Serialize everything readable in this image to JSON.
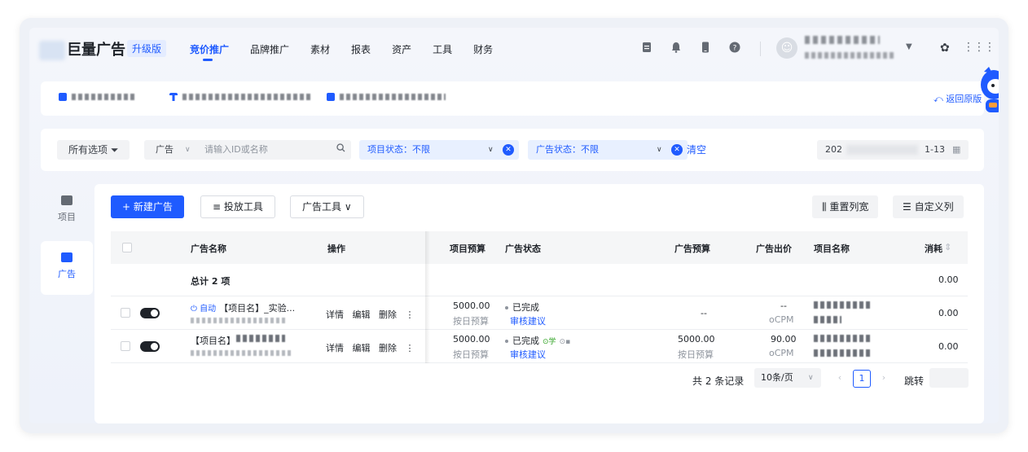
{
  "brand": {
    "title": "巨量广告",
    "edition": "升级版"
  },
  "nav": {
    "items": [
      "竞价推广",
      "品牌推广",
      "素材",
      "报表",
      "资产",
      "工具",
      "财务"
    ],
    "active": "竞价推广"
  },
  "account": {
    "back_label": "返回原版"
  },
  "filters": {
    "all_options": "所有选项",
    "search_type": "广告",
    "search_placeholder": "请输入ID或名称",
    "project_status": "项目状态：不限",
    "ad_status": "广告状态：不限",
    "clear": "清空",
    "date_prefix": "202",
    "date_suffix": "1-13"
  },
  "sidebar": {
    "items": [
      {
        "label": "项目"
      },
      {
        "label": "广告"
      }
    ],
    "active": "广告"
  },
  "toolbar": {
    "new_ad": "+ 新建广告",
    "delivery_tools": "≡ 投放工具",
    "ad_tools": "广告工具",
    "reset_cols": "重置列宽",
    "custom_cols": "自定义列"
  },
  "table": {
    "headers": {
      "name": "广告名称",
      "ops": "操作",
      "project_budget": "项目预算",
      "ad_status": "广告状态",
      "ad_budget": "广告预算",
      "ad_bid": "广告出价",
      "project_name": "项目名称",
      "spend": "消耗"
    },
    "total": {
      "label": "总计 2 项",
      "spend": "0.00"
    },
    "rows": [
      {
        "tag": "自动",
        "name": "【项目名】_实验...",
        "ops": [
          "详情",
          "编辑",
          "删除",
          "⋮"
        ],
        "project_budget": "5000.00",
        "project_budget_sub": "按日预算",
        "status": "已完成",
        "status_link": "审核建议",
        "ad_budget": "--",
        "ad_budget_sub": "",
        "bid": "--",
        "bid_sub": "oCPM",
        "spend": "0.00"
      },
      {
        "tag": "",
        "name": "【项目名】",
        "ops": [
          "详情",
          "编辑",
          "删除",
          "⋮"
        ],
        "project_budget": "5000.00",
        "project_budget_sub": "按日预算",
        "status": "已完成",
        "status_badge": "学",
        "status_link": "审核建议",
        "ad_budget": "5000.00",
        "ad_budget_sub": "按日预算",
        "bid": "90.00",
        "bid_sub": "oCPM",
        "spend": "0.00"
      }
    ]
  },
  "pagination": {
    "total_text": "共 2 条记录",
    "page_size": "10条/页",
    "current_page": "1",
    "jump_label": "跳转"
  },
  "colors": {
    "primary": "#1f5bff",
    "success": "#2ea121"
  }
}
